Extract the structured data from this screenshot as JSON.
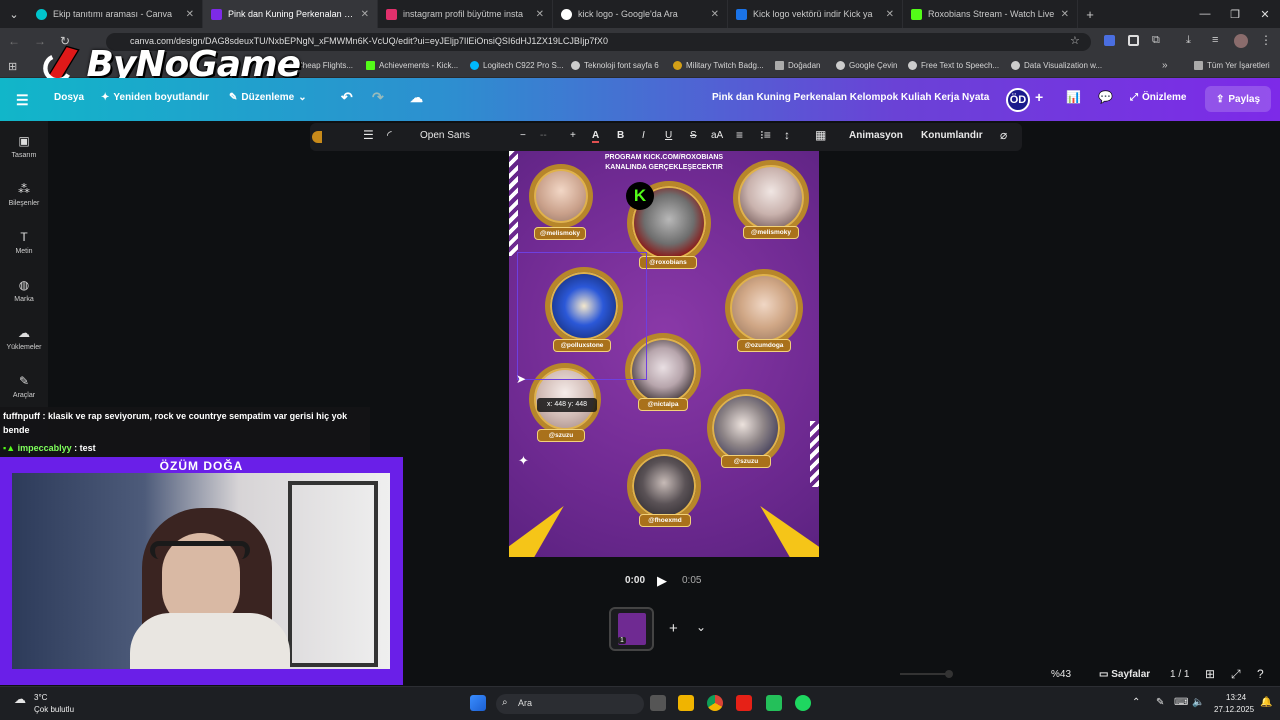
{
  "browser": {
    "tabs": [
      {
        "label": "Ekip tanıtımı araması - Canva",
        "color": "#00c4cc",
        "active": false
      },
      {
        "label": "Pink dan Kuning Perkenalan Ke",
        "color": "#7d2ae8",
        "active": true
      },
      {
        "label": "instagram profil büyütme insta",
        "color": "#e1306c",
        "active": false
      },
      {
        "label": "kick logo - Google'da Ara",
        "color": "#ffffff",
        "active": false
      },
      {
        "label": "Kick logo vektörü indir Kick ya",
        "color": "#1a73e8",
        "active": false
      },
      {
        "label": "Roxobians Stream - Watch Live",
        "color": "#53fc18",
        "active": false
      }
    ],
    "new_tab": "+",
    "url": "canva.com/design/DAG8sdeuxTU/NxbEPNgN_xFMWMn6K-VcUQ/edit?ui=eyJEljp7IlEiOnsiQSI6dHJ1ZX19LCJBIjp7fX0",
    "bookmarks": [
      {
        "label": "Cheap Flights...",
        "color": "#888888"
      },
      {
        "label": "Achievements - Kick...",
        "color": "#53fc18"
      },
      {
        "label": "Logitech C922 Pro S...",
        "color": "#00b8fc"
      },
      {
        "label": "Teknoloji font sayfa 6",
        "color": "#cccccc"
      },
      {
        "label": "Military Twitch Badg...",
        "color": "#d4a017"
      },
      {
        "label": "Doğadan",
        "color": "#aaaaaa"
      },
      {
        "label": "Google Çevin",
        "color": "#cccccc"
      },
      {
        "label": "Free Text to Speech...",
        "color": "#cccccc"
      },
      {
        "label": "Data Visualization w...",
        "color": "#cccccc"
      },
      {
        "label": "Tüm Yer İşaretleri",
        "color": "#aaaaaa"
      }
    ]
  },
  "logo": {
    "text": "ByNoGame"
  },
  "canva_header": {
    "file": "Dosya",
    "resize": "Yeniden boyutlandır",
    "edit": "Düzenleme",
    "title": "Pink dan Kuning Perkenalan Kelompok Kuliah Kerja Nyata In...",
    "avatar": "ÖD",
    "preview": "Önizleme",
    "share": "Paylaş"
  },
  "sidebar": {
    "items": [
      {
        "label": "Tasarım",
        "icon": "design-icon"
      },
      {
        "label": "Bileşenler",
        "icon": "elements-icon"
      },
      {
        "label": "Metin",
        "icon": "text-icon"
      },
      {
        "label": "Marka",
        "icon": "brand-icon"
      },
      {
        "label": "Yüklemeler",
        "icon": "upload-icon"
      },
      {
        "label": "Araçlar",
        "icon": "tools-icon"
      }
    ]
  },
  "toolbar": {
    "font": "Open Sans",
    "size": "--",
    "minus": "−",
    "plus": "+",
    "bold": "B",
    "italic": "I",
    "underline": "U",
    "strike": "S",
    "case": "aA",
    "animate": "Animasyon",
    "position": "Konumlandır"
  },
  "design": {
    "title_line1": "PROGRAM KICK.COM/ROXOBIANS",
    "title_line2": "KANALINDA GERÇEKLEŞECEKTIR",
    "kick_badge": "K",
    "handles": [
      "@melismoky",
      "@roxobians",
      "@melismoky",
      "@polluxstone",
      "@ozumdoga",
      "@nictalpa",
      "@szuzu",
      "@szuzu",
      "@fhoexmd"
    ],
    "coord_tooltip": "x: 448 y: 448"
  },
  "player": {
    "current": "0:00",
    "duration": "0:05",
    "page_count_badge": "1"
  },
  "bottom": {
    "zoom": "%43",
    "pages_label": "Sayfalar",
    "pages": "1 / 1"
  },
  "chat": [
    {
      "user": "fuffnpuff",
      "text": "klasik ve rap seviyorum, rock ve countrye sempatim var gerisi hiç yok bende"
    },
    {
      "user": "impeccablyy",
      "text": "test"
    }
  ],
  "webcam": {
    "name": "ÖZÜM DOĞA"
  },
  "taskbar": {
    "weather_temp": "3°C",
    "weather_desc": "Çok bulutlu",
    "search": "Ara",
    "time": "13:24",
    "date": "27.12.2025"
  }
}
